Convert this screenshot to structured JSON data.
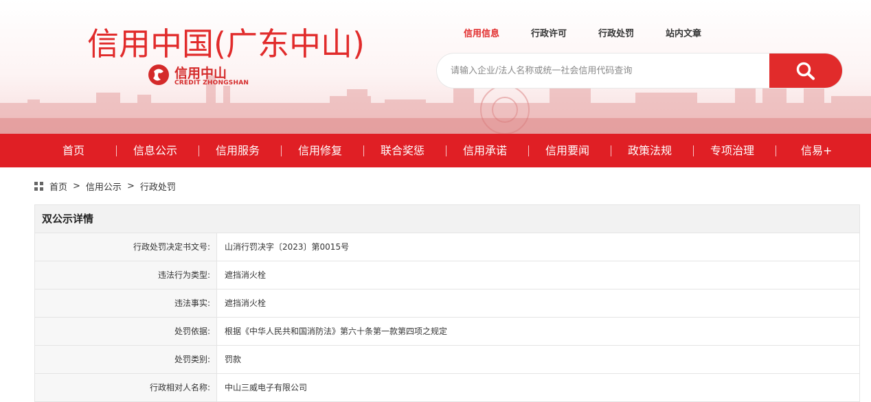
{
  "header": {
    "site_title": "信用中国(广东中山)",
    "logo_cn": "信用中山",
    "logo_en": "CREDIT ZHONGSHAN",
    "top_links": [
      "信用信息",
      "行政许可",
      "行政处罚",
      "站内文章"
    ],
    "active_top_link": "信用信息",
    "search_placeholder": "请输入企业/法人名称或统一社会信用代码查询",
    "brand_color": "#e12b2b"
  },
  "nav": {
    "items": [
      "首页",
      "信息公示",
      "信用服务",
      "信用修复",
      "联合奖惩",
      "信用承诺",
      "信用要闻",
      "政策法规",
      "专项治理",
      "信易+"
    ]
  },
  "breadcrumb": {
    "items": [
      "首页",
      "信用公示",
      "行政处罚"
    ],
    "separator": ">"
  },
  "detail": {
    "title": "双公示详情",
    "rows": [
      {
        "label": "行政处罚决定书文号:",
        "value": "山消行罚决字〔2023〕第0015号"
      },
      {
        "label": "违法行为类型:",
        "value": "遮挡消火栓"
      },
      {
        "label": "违法事实:",
        "value": "遮挡消火栓"
      },
      {
        "label": "处罚依据:",
        "value": "根据《中华人民共和国消防法》第六十条第一款第四项之规定"
      },
      {
        "label": "处罚类别:",
        "value": "罚款"
      },
      {
        "label": "行政相对人名称:",
        "value": "中山三威电子有限公司"
      }
    ]
  }
}
